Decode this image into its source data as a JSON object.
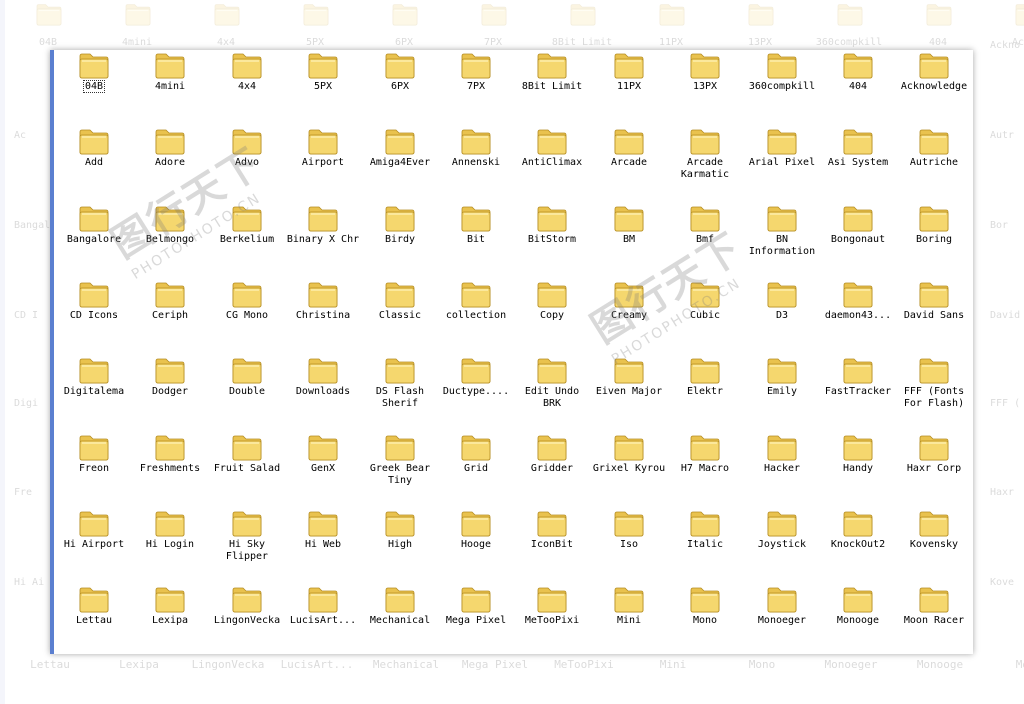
{
  "colors": {
    "accent": "#5b7fd0",
    "folder_body": "#f5d76e",
    "folder_tab": "#e9c24e"
  },
  "icons": {
    "folder": "folder-icon"
  },
  "background": {
    "top_labels": [
      "04B",
      "4mini",
      "4x4",
      "5PX",
      "6PX",
      "7PX",
      "8Bit Limit",
      "11PX",
      "13PX",
      "360compkill",
      "404",
      "Ackno"
    ],
    "bottom_labels": [
      "Lettau",
      "Lexipa",
      "LingonVecka",
      "LucisArt...",
      "Mechanical",
      "Mega Pixel",
      "MeTooPixi",
      "Mini",
      "Mono",
      "Monoeger",
      "Monooge",
      "Moon"
    ],
    "left_labels": [
      "Ac",
      "Bangalo",
      "CD I",
      "Digi",
      "Fre",
      "Hi Ai"
    ],
    "right_labels": [
      "Ackno",
      "Autr",
      "Bor",
      "David",
      "FFF (",
      "Haxr",
      "Kove"
    ]
  },
  "watermark": {
    "text_main": "图行天下",
    "text_sub": "PHOTOPHOTO.CN"
  },
  "folders": [
    [
      "04B",
      "4mini",
      "4x4",
      "5PX",
      "6PX",
      "7PX",
      "8Bit Limit",
      "11PX",
      "13PX",
      "360compkill",
      "404",
      "Acknowledge"
    ],
    [
      "Add",
      "Adore",
      "Advo",
      "Airport",
      "Amiga4Ever",
      "Annenski",
      "AntiClimax",
      "Arcade",
      "Arcade Karmatic",
      "Arial Pixel",
      "Asi System",
      "Autriche"
    ],
    [
      "Bangalore",
      "Belmongo",
      "Berkelium",
      "Binary X Chr",
      "Birdy",
      "Bit",
      "BitStorm",
      "BM",
      "Bmf",
      "BN Information",
      "Bongonaut",
      "Boring"
    ],
    [
      "CD Icons",
      "Ceriph",
      "CG Mono",
      "Christina",
      "Classic",
      "collection",
      "Copy",
      "Creamy",
      "Cubic",
      "D3",
      "daemon43...",
      "David Sans"
    ],
    [
      "Digitalema",
      "Dodger",
      "Double",
      "Downloads",
      "DS Flash Sherif",
      "Ductype....",
      "Edit Undo BRK",
      "Eiven Major",
      "Elektr",
      "Emily",
      "FastTracker",
      "FFF (Fonts For Flash)"
    ],
    [
      "Freon",
      "Freshments",
      "Fruit Salad",
      "GenX",
      "Greek Bear Tiny",
      "Grid",
      "Gridder",
      "Grixel Kyrou",
      "H7 Macro",
      "Hacker",
      "Handy",
      "Haxr Corp"
    ],
    [
      "Hi Airport",
      "Hi Login",
      "Hi Sky Flipper",
      "Hi Web",
      "High",
      "Hooge",
      "IconBit",
      "Iso",
      "Italic",
      "Joystick",
      "KnockOut2",
      "Kovensky"
    ],
    [
      "Lettau",
      "Lexipa",
      "LingonVecka",
      "LucisArt...",
      "Mechanical",
      "Mega Pixel",
      "MeTooPixi",
      "Mini",
      "Mono",
      "Monoeger",
      "Monooge",
      "Moon Racer"
    ]
  ],
  "selected": "04B"
}
